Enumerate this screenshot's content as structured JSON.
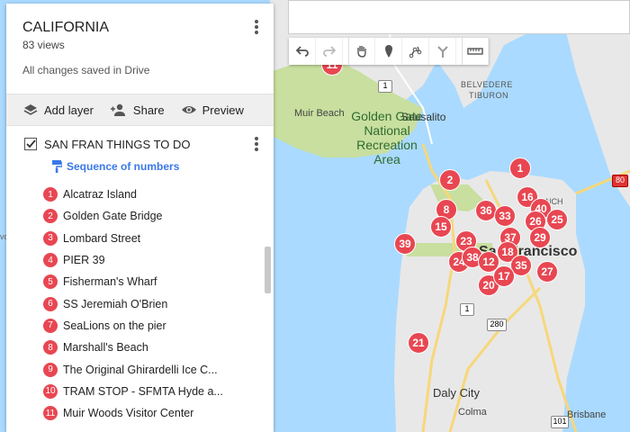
{
  "panel": {
    "title": "CALIFORNIA",
    "views": "83 views",
    "saved_status": "All changes saved in Drive",
    "actions": {
      "add_layer": "Add layer",
      "share": "Share",
      "preview": "Preview"
    },
    "layer": {
      "name": "SAN FRAN THINGS TO DO",
      "style_link": "Sequence of numbers",
      "items": [
        {
          "n": "1",
          "label": "Alcatraz Island"
        },
        {
          "n": "2",
          "label": "Golden Gate Bridge"
        },
        {
          "n": "3",
          "label": "Lombard Street"
        },
        {
          "n": "4",
          "label": "PIER 39"
        },
        {
          "n": "5",
          "label": "Fisherman's Wharf"
        },
        {
          "n": "6",
          "label": "SS Jeremiah O'Brien"
        },
        {
          "n": "7",
          "label": "SeaLions on the pier"
        },
        {
          "n": "8",
          "label": "Marshall's Beach"
        },
        {
          "n": "9",
          "label": "The Original Ghirardelli Ice C..."
        },
        {
          "n": "10",
          "label": "TRAM STOP - SFMTA Hyde a..."
        },
        {
          "n": "11",
          "label": "Muir Woods Visitor Center"
        }
      ]
    }
  },
  "map": {
    "labels": {
      "muir_beach": "Muir Beach",
      "ggnra": [
        "Golden Gate",
        "National",
        "Recreation",
        "Area"
      ],
      "sausalito": "Sausalito",
      "belvedere_tiburon": [
        "BELVEDERE",
        "TIBURON"
      ],
      "san_francisco": "San Francisco",
      "daly_city": "Daly City",
      "colma": "Colma",
      "brisbane": "Brisbane",
      "french": "NCH",
      "shield_1": "1",
      "shield_101": "101",
      "shield_280": "280",
      "shield_80": "80",
      "edge_text": "vo"
    },
    "markers": [
      "1",
      "2",
      "8",
      "15",
      "36",
      "33",
      "16",
      "40",
      "26",
      "25",
      "37",
      "39",
      "23",
      "18",
      "29",
      "24",
      "38",
      "12",
      "35",
      "20",
      "17",
      "27",
      "21",
      "11"
    ]
  },
  "colors": {
    "water": "#aadaff",
    "land": "#e8e8e8",
    "park": "#c8df9f",
    "marker": "#e84752",
    "link": "#3b78e7"
  },
  "icons": [
    "undo-icon",
    "redo-icon",
    "hand-icon",
    "pin-icon",
    "draw-line-icon",
    "directions-icon",
    "ruler-icon",
    "more-vert-icon",
    "layers-icon",
    "add-person-icon",
    "eye-icon",
    "check-icon",
    "paint-roller-icon"
  ]
}
